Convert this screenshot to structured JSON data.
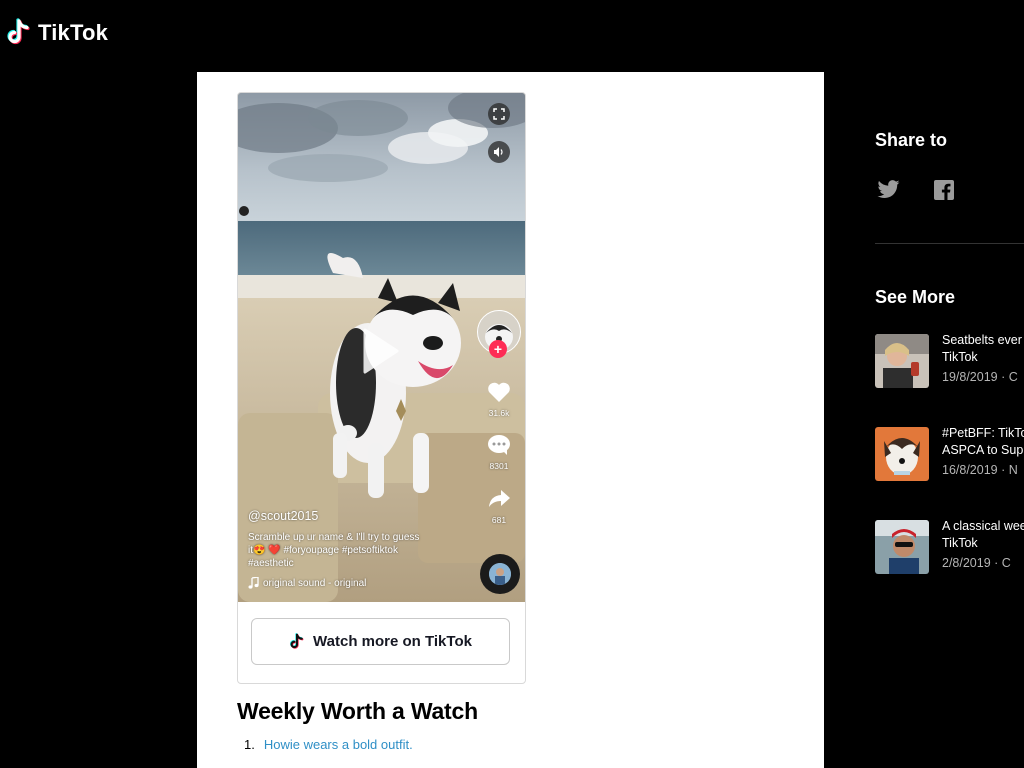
{
  "brand": {
    "name": "TikTok",
    "accent": "#fe2c55",
    "cyan": "#25f4ee"
  },
  "player": {
    "author": "@scout2015",
    "caption_line1": "Scramble up ur name & I'll try to guess",
    "caption_line2": "it😍 ❤️  #foryoupage #petsoftiktok",
    "caption_line3": "#aesthetic",
    "sound": "original sound - original",
    "likes": "31.6k",
    "comments": "8301",
    "shares": "681",
    "follow_symbol": "+",
    "watch_more_label": "Watch more on TikTok",
    "icons": [
      "fullscreen-icon",
      "volume-icon",
      "play-icon",
      "heart-icon",
      "comment-icon",
      "share-icon",
      "music-note-icon"
    ]
  },
  "article": {
    "heading": "Weekly Worth a Watch",
    "items": [
      {
        "number": "1.",
        "link": "Howie wears a bold outfit."
      }
    ]
  },
  "sidebar": {
    "share_heading": "Share to",
    "share_icons": [
      "twitter-icon",
      "facebook-icon"
    ],
    "see_more_heading": "See More",
    "items": [
      {
        "title": "Seatbelts ever\nTikTok",
        "date": "19/8/2019 · C"
      },
      {
        "title": "#PetBFF: TikTo\nASPCA to Supp",
        "date": "16/8/2019 · N"
      },
      {
        "title": "A classical wee\nTikTok",
        "date": "2/8/2019 · C"
      }
    ]
  }
}
